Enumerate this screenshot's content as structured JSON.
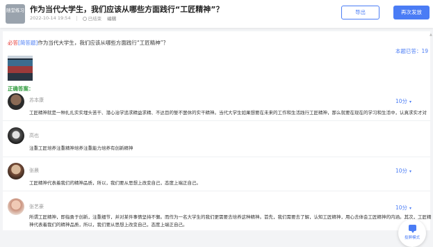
{
  "header": {
    "badge": "随堂练习",
    "title": "作为当代大学生，我们应该从哪些方面践行“工匠精神”？",
    "date": "2022-10-14 19:54",
    "status": "已结束",
    "edit": "编辑",
    "export_label": "导出",
    "resend_label": "再次发放"
  },
  "question": {
    "required": "必答",
    "type": "[简答题]",
    "text": "作为当代大学生，我们应该从哪些方面践行“工匠精神”？",
    "answered_count": "本题已答：19",
    "correct_label": "正确答案："
  },
  "answers": [
    {
      "name": "苏本康",
      "score": "10分",
      "text": "工匠精神就是一种扎扎实实埋头苦干、潜心治学追求精益求精、不达目的誓不罢休的实干精神。当代大学生如果想要在未来的工作和生活践行工匠精神，那么就要在现在的学习和生活中，认真求实才对"
    },
    {
      "name": "高也",
      "score": "",
      "text": "注重工匠培养注重精神培养注重能力培养有创新精神"
    },
    {
      "name": "张晨",
      "score": "10分",
      "text": "工匠精神代表着我们的精神品质，所以，我们要从思想上改变自己，态度上端正自己。"
    },
    {
      "name": "张艺豪",
      "score": "10分",
      "text": "所谓工匠精神，即指勇于创新，注重细节，并对某件事情坚持不懈。而作为一名大学生的我们更需要去培养这种精神。首先，我们需要去了解，认知工匠精神，用心去体会工匠精神的内涵。其次，工匠精神代表着我们的精神品质，所以，我们要从思想上改变自己，态度上端正自己。"
    }
  ],
  "view_mode": "投屏模式",
  "colors": {
    "accent": "#4a7cf5",
    "required": "#e53935",
    "correct": "#2e9b3c"
  }
}
